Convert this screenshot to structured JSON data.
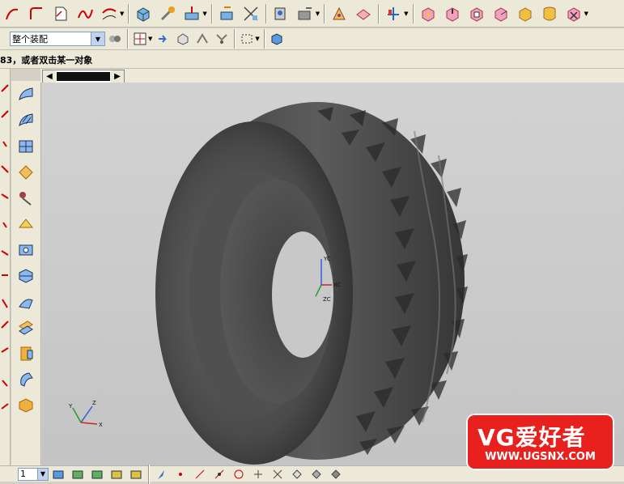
{
  "toolbar": {
    "assembly_scope": "整个装配"
  },
  "status_message": "83，或者双击某一对象",
  "scroll_arrows": {
    "left": "◀",
    "right": "▶"
  },
  "axes_view": {
    "yc": "YC",
    "xc": "XC",
    "zc": "ZC"
  },
  "axes_corner": {
    "x": "X",
    "y": "Y",
    "z": "Z"
  },
  "watermark": {
    "title": "VG爱好者",
    "url": "WWW.UGSNX.COM"
  },
  "bottom": {
    "layer_value": "1"
  },
  "colors": {
    "tire": "#4a4a4a",
    "viewport": "#c8c8c8",
    "badge": "#e8201e"
  }
}
